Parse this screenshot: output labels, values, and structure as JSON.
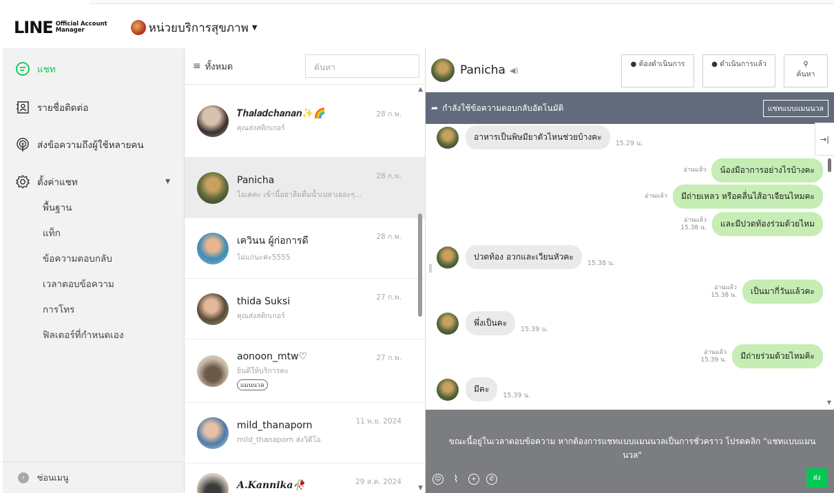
{
  "header": {
    "logo_text": "LINE",
    "logo_sub_1": "Official Account",
    "logo_sub_2": "Manager",
    "account_name": "หน่วยบริการสุขภาพ"
  },
  "sidebar": {
    "items": [
      {
        "label": "แชท",
        "icon": "chat-icon",
        "active": true
      },
      {
        "label": "รายชื่อติดต่อ",
        "icon": "contacts-icon"
      },
      {
        "label": "ส่งข้อความถึงผู้ใช้หลายคน",
        "icon": "broadcast-icon"
      },
      {
        "label": "ตั้งค่าแชท",
        "icon": "gear-icon"
      }
    ],
    "subitems": [
      "พื้นฐาน",
      "แท็ก",
      "ข้อความตอบกลับ",
      "เวลาตอบข้อความ",
      "การโทร",
      "ฟิลเตอร์ที่กำหนดเอง"
    ],
    "collapse_label": "ซ่อนเมนู"
  },
  "list": {
    "filter_label": "ทั้งหมด",
    "search_placeholder": "ค้นหา",
    "chats": [
      {
        "name": "𝑻𝒉𝒂𝒍𝒂𝒅𝒄𝒉𝒂𝒏𝒂𝒏✨🌈",
        "preview": "คุณส่งสติกเกอร์",
        "date": "28 ก.พ."
      },
      {
        "name": "Panicha",
        "preview": "โอเคคะ เข้านี้อย่าลืมดื่มน้ำเปล่าเยอะๆ...",
        "date": "28 ก.พ."
      },
      {
        "name": "เควินน ผู้ก่อการดี",
        "preview": "ไม่แก่นะค่ะ5555",
        "date": "28 ก.พ."
      },
      {
        "name": "thida Suksi",
        "preview": "คุณส่งสติกเกอร์",
        "date": "27 ก.พ."
      },
      {
        "name": "aonoon_mtw♡",
        "preview": "ยินดีให้บริการคะ",
        "date": "27 ก.พ.",
        "tag": "แมนนวล"
      },
      {
        "name": "mild_thanaporn",
        "preview": "mild_thanaporn ส่งวิดีโอ",
        "date": "11 พ.ย. 2024"
      },
      {
        "name": "𝑨.𝑲𝒂𝒏𝒏𝒊𝒌𝒂🥀",
        "preview": "",
        "date": "29 ส.ค. 2024"
      }
    ]
  },
  "room": {
    "name": "Panicha",
    "btn_todo": "ต้องดำเนินการ",
    "btn_done": "ดำเนินการแล้ว",
    "btn_search": "ค้นหา",
    "banner_text": "กำลังใช้ข้อความตอบกลับอัตโนมัติ",
    "banner_manual": "แชทแบบแมนนวล",
    "messages": [
      {
        "dir": "in",
        "text": "อาหารเป็นพิษมียาตัวไหนช่วยบ้างคะ",
        "time": "15.29 น."
      },
      {
        "dir": "out",
        "text": "น้องมีอาการอย่างไรบ้างคะ",
        "read": "อ่านแล้ว",
        "time": ""
      },
      {
        "dir": "out",
        "text": "มีถ่ายเหลว หรือคลื่นไส้อาเจียนไหมคะ",
        "read": "อ่านแล้ว",
        "time": ""
      },
      {
        "dir": "out",
        "text": "และมีปวดท้องร่วมด้วยไหม",
        "read": "อ่านแล้ว",
        "time": "15.38 น."
      },
      {
        "dir": "in",
        "text": "ปวดท้อง อวกและเวียนหัวคะ",
        "time": "15.38 น."
      },
      {
        "dir": "out",
        "text": "เป็นมากี่วันแล้วคะ",
        "read": "อ่านแล้ว",
        "time": "15.38 น."
      },
      {
        "dir": "in",
        "text": "พึ่งเป็นคะ",
        "time": "15.39 น."
      },
      {
        "dir": "out",
        "text": "มีถ่ายร่วมด้วยไหมคิะ",
        "read": "อ่านแล้ว",
        "time": "15.39 น."
      },
      {
        "dir": "in",
        "text": "มีคะ",
        "time": "15.39 น."
      }
    ],
    "footer_notice": "ขณะนี้อยู่ในเวลาตอบข้อความ หากต้องการแชทแบบแมนนวลเป็นการชั่วคราว โปรดคลิก \"แชทแบบแมนนวล\"",
    "send_label": "ส่ง"
  },
  "colors": {
    "brand_green": "#06c755",
    "banner": "#626b7c",
    "bubble_out": "#c5edb4"
  }
}
